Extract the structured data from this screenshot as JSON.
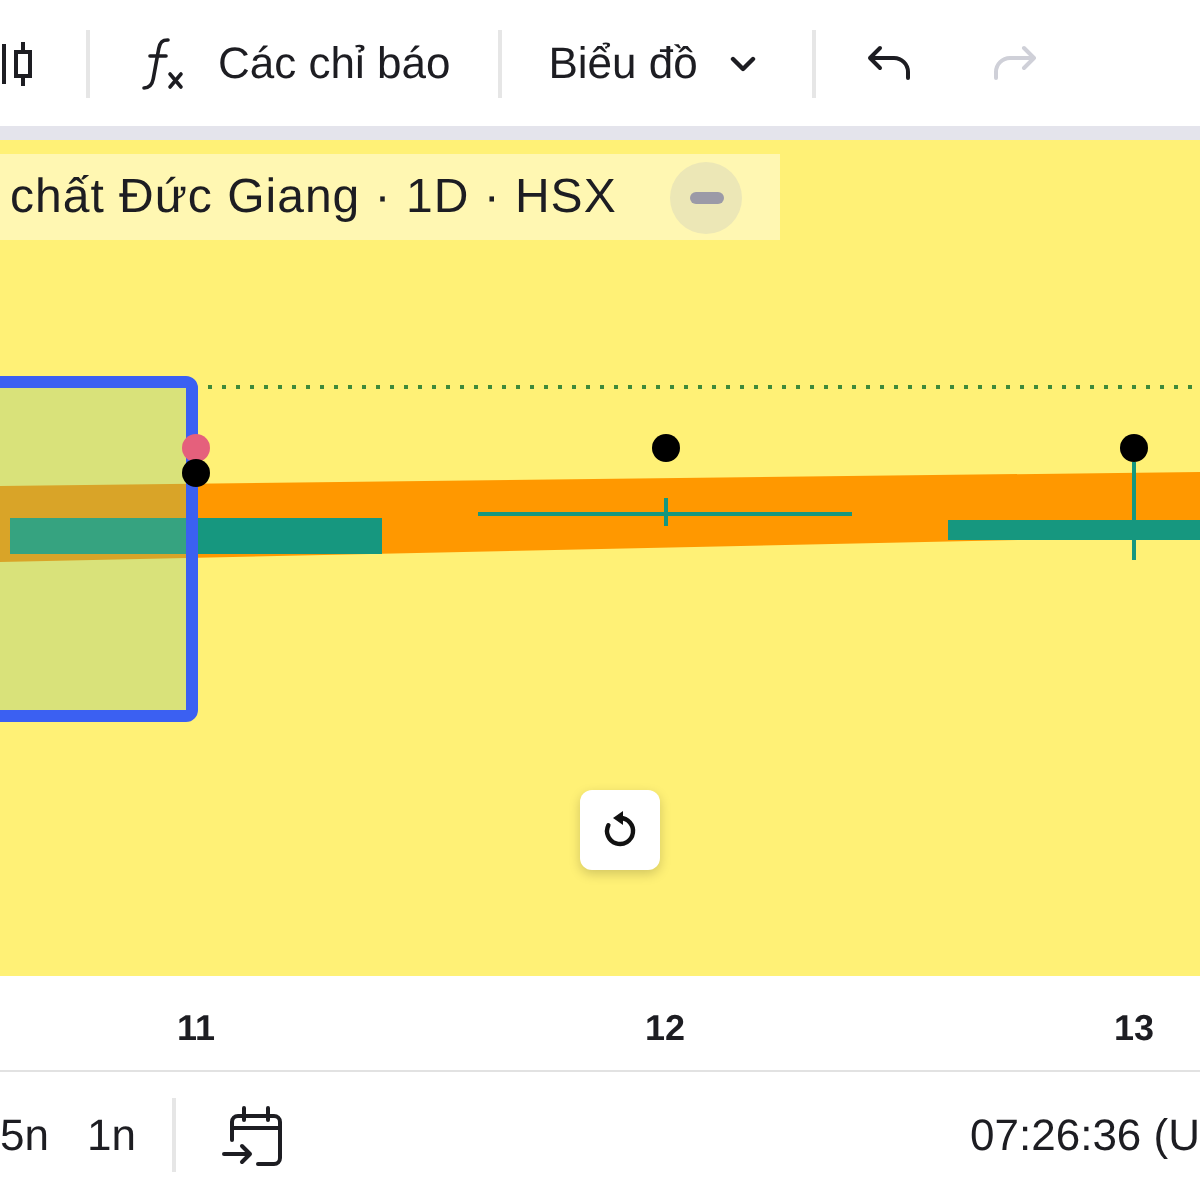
{
  "toolbar": {
    "indicators": {
      "label": "Các chỉ báo"
    },
    "chart_type": {
      "label": "Biểu đồ"
    },
    "undo": {
      "disabled": false
    },
    "redo": {
      "disabled": true
    }
  },
  "legend": {
    "title": "chất Đức Giang · 1D · HSX"
  },
  "time_axis": {
    "labels": [
      "11",
      "12",
      "13"
    ]
  },
  "bottom_bar": {
    "ranges": [
      {
        "label": "5n",
        "selected": false
      },
      {
        "label": "1n",
        "selected": false
      }
    ],
    "clock": "07:26:36 (U"
  }
}
